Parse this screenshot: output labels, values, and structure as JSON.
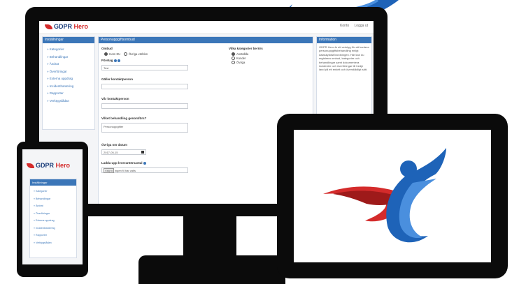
{
  "monitor_app": {
    "logo_text": "GDPR",
    "logo_hero": "Hero",
    "top_links": [
      "Konto",
      "Logga ut"
    ],
    "sidebar": {
      "title": "Inställningar",
      "items": [
        "» Kategorier",
        "» Behandlingar",
        "» Ändrat",
        "» Överföringar",
        "» Externa uppdrag",
        "» Incidenthantering",
        "» Rapporter",
        "» Verktygslådan"
      ]
    },
    "main": {
      "title": "Personuppgiftsombud",
      "section_label": "Ombud",
      "radio_options": [
        "Inom EU",
        "Övriga världen"
      ],
      "field1_label": "Företag",
      "field1_value": "Test",
      "field2_label": "Gäller kontaktperson",
      "field3_label": "Vår kontaktperson",
      "field4_label": "Vilket behandling genomförs?",
      "field4_value": "Personuppgifter",
      "field5_label": "Övriga om datum",
      "field5_value": "2017-05-15",
      "field6_label": "Ladda upp leverantörsavtal",
      "upload_button": "Välj fil",
      "upload_status": "Ingen fil har valts",
      "categories_title": "Vilka kategorier berörs",
      "categories": [
        "Anställda",
        "Kunder",
        "Övriga"
      ]
    },
    "info": {
      "title": "Information",
      "text": "GDPR Hero är ett verktyg för att hantera personuppgiftsbehandling enligt dataskyddsförordningen. Här kan du registrera ombud, kategorier och behandlingar samt dokumentera incidenter och överföringar till tredje land på ett enkelt och överskådligt sätt."
    }
  },
  "phone_app": {
    "logo_text": "GDPR",
    "logo_hero": "Hero",
    "menu_title": "Inställningar",
    "items": [
      "» Kategorier",
      "» Behandlingar",
      "» Ändrat",
      "» Överföringar",
      "» Externa uppdrag",
      "» Incidenthantering",
      "» Rapporter",
      "» Verktygslådan"
    ]
  },
  "colors": {
    "brand_blue": "#1a3d7a",
    "brand_red": "#d42b2b",
    "panel_header": "#3b76b8",
    "arrow_blue": "#1e63b8",
    "device_black": "#0b0b0b"
  },
  "icons": [
    "arrow-pointer-icon",
    "gdpr-hero-logo-icon",
    "info-hint-icon",
    "calendar-icon"
  ]
}
